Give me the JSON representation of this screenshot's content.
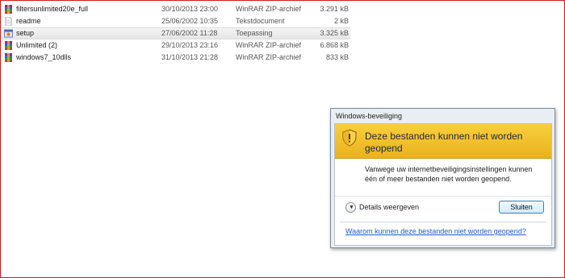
{
  "files": [
    {
      "name": "filtersunlimited20e_full",
      "date": "30/10/2013 23:00",
      "type": "WinRAR ZIP-archief",
      "size": "3.291 kB",
      "icon": "winrar-archive-icon",
      "selected": false
    },
    {
      "name": "readme",
      "date": "25/06/2002 10:35",
      "type": "Tekstdocument",
      "size": "2 kB",
      "icon": "text-document-icon",
      "selected": false
    },
    {
      "name": "setup",
      "date": "27/06/2002 11:28",
      "type": "Toepassing",
      "size": "3.325 kB",
      "icon": "application-icon",
      "selected": true
    },
    {
      "name": "Unlimited (2)",
      "date": "29/10/2013 23:16",
      "type": "WinRAR ZIP-archief",
      "size": "6.868 kB",
      "icon": "winrar-archive-icon",
      "selected": false
    },
    {
      "name": "windows7_10dlls",
      "date": "31/10/2013 21:28",
      "type": "WinRAR ZIP-archief",
      "size": "833 kB",
      "icon": "winrar-archive-icon",
      "selected": false
    }
  ],
  "dialog": {
    "title": "Windows-beveiliging",
    "heading": "Deze bestanden kunnen niet worden geopend",
    "message": "Vanwege uw internetbeveiligingsinstellingen kunnen één of meer bestanden niet worden geopend.",
    "details_label": "Details weergeven",
    "close_label": "Sluiten",
    "help_link": "Waarom kunnen deze bestanden niet worden geopend?",
    "icon": "warning-shield-icon",
    "header_color": "#f0be2a",
    "link_color": "#1d5ccf"
  },
  "frame_color": "#d21a1a"
}
